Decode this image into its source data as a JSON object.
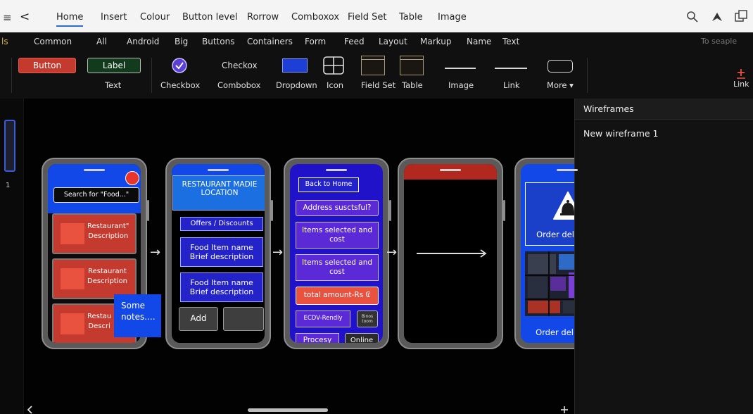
{
  "menubar": {
    "left_glyph": "≡",
    "back": "<",
    "items": [
      "Home",
      "Insert",
      "Colour",
      "Button level",
      "Rorrow",
      "Comboxox",
      "Field Set",
      "Table",
      "Image"
    ],
    "right_icons": [
      "search-icon",
      "share-icon",
      "windows-icon"
    ]
  },
  "palette": {
    "categories": [
      "ls",
      "Common",
      "All",
      "Android",
      "Big",
      "Buttons",
      "Containers",
      "Form",
      "Feed",
      "Layout",
      "Markup",
      "Name",
      "Text"
    ],
    "search_placeholder": "To seaple",
    "button_label": "Button",
    "label_label": "Label",
    "text_caption": "Text",
    "checkbox_caption": "Checkbox",
    "checkox_text": "Checkox",
    "combobox_caption": "Combobox",
    "dropdown_caption": "Dropdown",
    "icon_caption": "Icon",
    "fieldset_caption": "Field Set",
    "table_caption": "Table",
    "image_caption": "Image",
    "link_caption": "Link",
    "more_caption": "More ▾",
    "link_right": "Link",
    "colors": {
      "button": "#c43a2e",
      "label": "#123a1d",
      "accent": "#2b6cd6"
    }
  },
  "leftstrip": {
    "label": "1"
  },
  "right_panel": {
    "header": "Wireframes",
    "items": [
      "New wireframe 1"
    ]
  },
  "phone1": {
    "search": "Search for \"Food...\"",
    "cards": [
      {
        "line1": "Restaurant\"",
        "line2": "Description"
      },
      {
        "line1": "Restaurant",
        "line2": "Description"
      },
      {
        "line1": "Restau",
        "line2": "Descri"
      }
    ],
    "note": "Some notes...."
  },
  "phone2": {
    "header": "RESTAURANT MADIE LOCATION",
    "offers": "Offers / Discounts",
    "item1": "Food Item name Brief description",
    "item2": "Food Item name Brief description",
    "add": "Add"
  },
  "phone3": {
    "back": "Back to Home",
    "address": "Address susctsful?",
    "items1": "Items selected and cost",
    "items2": "Items selected and cost",
    "total": "total amount-Rs ₢",
    "eco": "ECDV-Rendly",
    "small": "Binos toom",
    "process": "Procesy",
    "online": "Online"
  },
  "phone5": {
    "delivered1": "Order delivered",
    "delivered2": "Order delivered"
  }
}
